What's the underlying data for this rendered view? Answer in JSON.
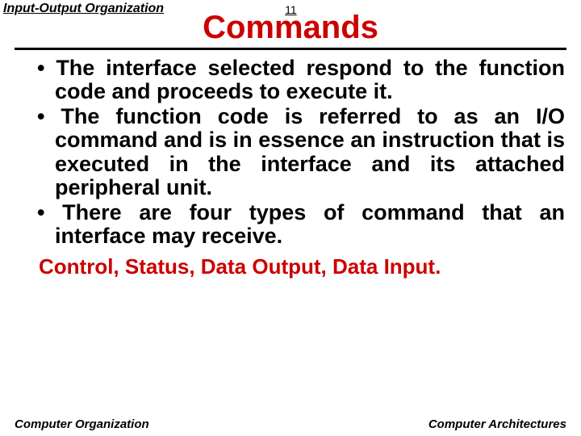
{
  "header": {
    "topic": "Input-Output Organization",
    "page_number": "11"
  },
  "title": "Commands",
  "bullets": [
    "The interface selected respond to the function code and proceeds to execute it.",
    "The function code is referred to as an I/O command and is in essence an instruction that is executed in the interface and its attached peripheral unit.",
    "There are four types of command that an interface may receive."
  ],
  "command_types": "Control, Status, Data Output, Data Input.",
  "footer": {
    "left": "Computer Organization",
    "right": "Computer Architectures"
  }
}
